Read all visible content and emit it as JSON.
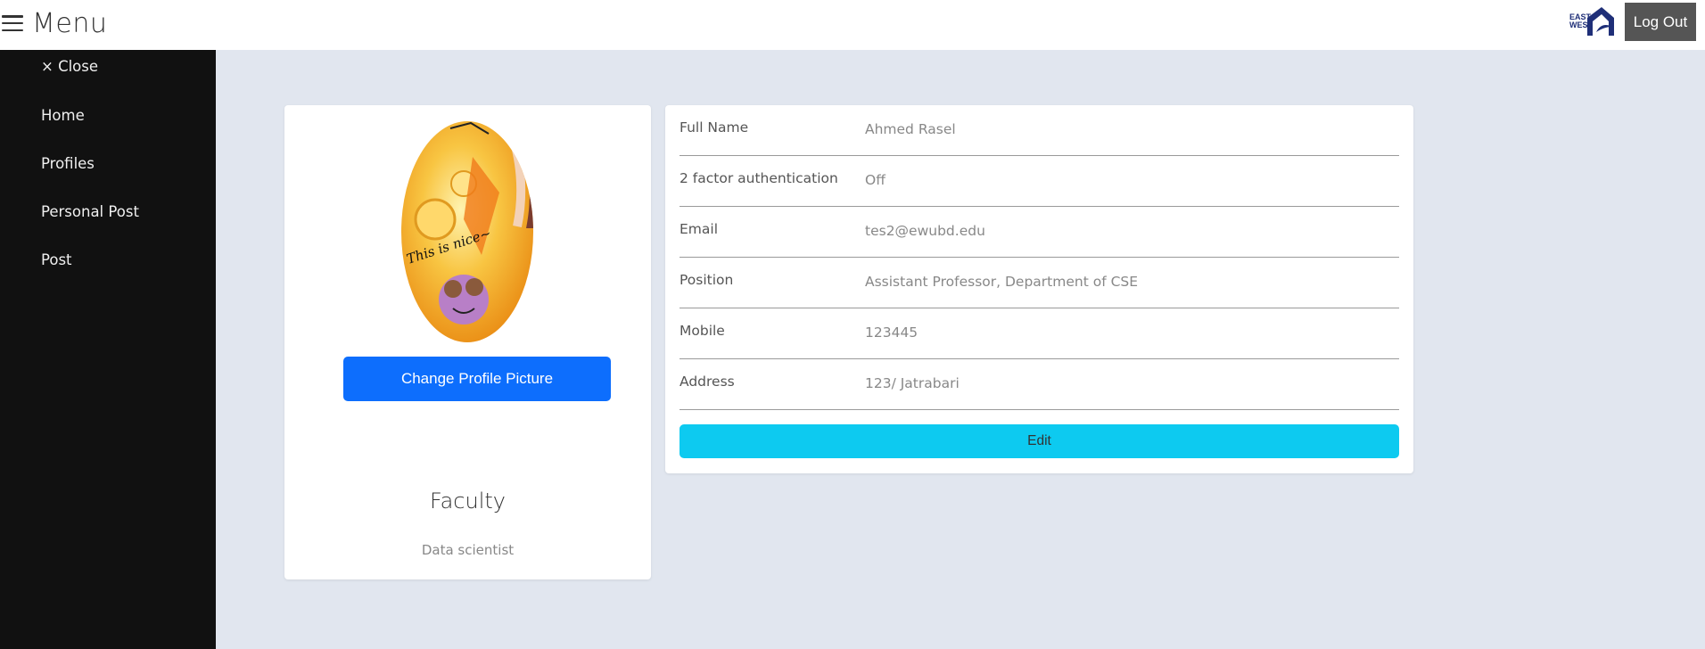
{
  "header": {
    "menu_label": "Menu",
    "logout_label": "Log Out",
    "logo_text": "EAST WEST"
  },
  "sidebar": {
    "close_label": "× Close",
    "items": [
      {
        "label": "Home"
      },
      {
        "label": "Profiles"
      },
      {
        "label": "Personal Post"
      },
      {
        "label": "Post"
      }
    ]
  },
  "profile": {
    "avatar_caption": "This is nice~",
    "change_picture_label": "Change Profile Picture",
    "role": "Faculty",
    "subtitle": "Data scientist"
  },
  "details": {
    "rows": [
      {
        "label": "Full Name",
        "value": "Ahmed Rasel"
      },
      {
        "label": "2 factor authentication",
        "value": "Off"
      },
      {
        "label": "Email",
        "value": "tes2@ewubd.edu"
      },
      {
        "label": "Position",
        "value": "Assistant Professor, Department of CSE"
      },
      {
        "label": "Mobile",
        "value": "123445"
      },
      {
        "label": "Address",
        "value": "123/ Jatrabari"
      }
    ],
    "edit_label": "Edit"
  },
  "colors": {
    "page_bg": "#e1e6ef",
    "sidebar_bg": "#111111",
    "primary": "#0d6efd",
    "info": "#0dcaf0",
    "logout_bg": "#555555"
  }
}
